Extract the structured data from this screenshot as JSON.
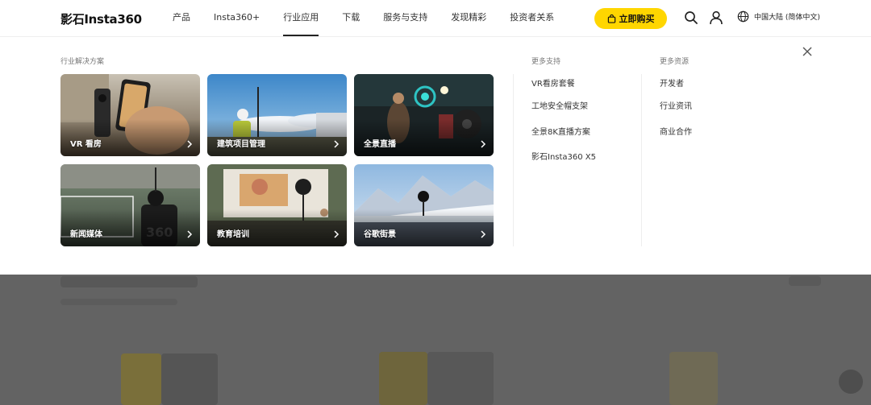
{
  "brand": {
    "logo": "影石Insta360"
  },
  "nav": {
    "items": [
      "产品",
      "Insta360+",
      "行业应用",
      "下载",
      "服务与支持",
      "发现精彩",
      "投资者关系"
    ],
    "active_index": 2
  },
  "header": {
    "buy_label": "立即购买",
    "language": "中国大陆 (简体中文)",
    "accent_color": "#ffd600"
  },
  "dropdown": {
    "solutions_title": "行业解决方案",
    "cards": [
      {
        "label": "VR 看房"
      },
      {
        "label": "建筑项目管理"
      },
      {
        "label": "全景直播"
      },
      {
        "label": "新闻媒体"
      },
      {
        "label": "教育培训"
      },
      {
        "label": "谷歌街景"
      }
    ],
    "support": {
      "title": "更多支持",
      "links": [
        "VR看房套餐",
        "工地安全帽支架",
        "全景8K直播方案",
        "影石Insta360 X5"
      ]
    },
    "resources": {
      "title": "更多资源",
      "links": [
        "开发者",
        "行业资讯",
        "商业合作"
      ]
    }
  }
}
